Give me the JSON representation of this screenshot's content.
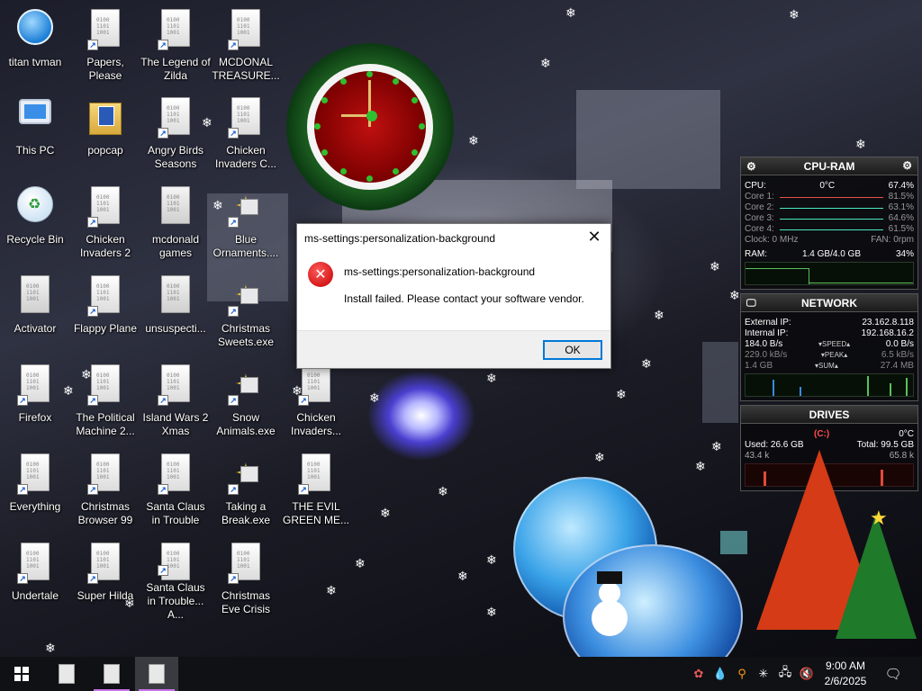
{
  "desktop": {
    "icons": [
      {
        "label": "titan tvman",
        "kind": "app"
      },
      {
        "label": "Papers, Please",
        "kind": "doc"
      },
      {
        "label": "The Legend of Zilda",
        "kind": "doc"
      },
      {
        "label": "MCDONAL TREASURE...",
        "kind": "doc"
      },
      {
        "label": "This PC",
        "kind": "pc"
      },
      {
        "label": "popcap",
        "kind": "folder"
      },
      {
        "label": "Angry Birds Seasons",
        "kind": "doc"
      },
      {
        "label": "Chicken Invaders C...",
        "kind": "doc"
      },
      {
        "label": "Recycle Bin",
        "kind": "bin"
      },
      {
        "label": "Chicken Invaders 2",
        "kind": "doc"
      },
      {
        "label": "mcdonald games",
        "kind": "file"
      },
      {
        "label": "Blue Ornaments....",
        "kind": "ornament"
      },
      {
        "label": "Activator",
        "kind": "file"
      },
      {
        "label": "Flappy Plane",
        "kind": "doc"
      },
      {
        "label": "unsuspecti...",
        "kind": "file"
      },
      {
        "label": "Christmas Sweets.exe",
        "kind": "ornament"
      },
      {
        "label": "Firefox",
        "kind": "doc"
      },
      {
        "label": "The Political Machine 2...",
        "kind": "doc"
      },
      {
        "label": "Island Wars 2 Xmas",
        "kind": "doc"
      },
      {
        "label": "Snow Animals.exe",
        "kind": "ornament"
      },
      {
        "label": "Chicken Invaders...",
        "kind": "doc"
      },
      {
        "label": "Everything",
        "kind": "doc"
      },
      {
        "label": "Christmas Browser 99",
        "kind": "doc"
      },
      {
        "label": "Santa Claus in Trouble",
        "kind": "doc"
      },
      {
        "label": "Taking a Break.exe",
        "kind": "ornament"
      },
      {
        "label": "THE EVIL GREEN ME...",
        "kind": "doc"
      },
      {
        "label": "Undertale",
        "kind": "doc"
      },
      {
        "label": "Super Hilda",
        "kind": "doc"
      },
      {
        "label": "Santa Claus in Trouble... A...",
        "kind": "doc"
      },
      {
        "label": "Christmas Eve Crisis",
        "kind": "doc"
      }
    ]
  },
  "dialog": {
    "title": "ms-settings:personalization-background",
    "close_glyph": "✕",
    "heading": "ms-settings:personalization-background",
    "message": "Install failed. Please contact your software vendor.",
    "ok_label": "OK",
    "icon": "error-icon"
  },
  "cpu_ram": {
    "title": "CPU-RAM",
    "cpu_label": "CPU:",
    "cpu_temp": "0°C",
    "cpu_percent": "67.4%",
    "cores": [
      {
        "label": "Core 1:",
        "value": "81.5%",
        "color": "#e8504a"
      },
      {
        "label": "Core 2:",
        "value": "63.1%",
        "color": "#4ae8c0"
      },
      {
        "label": "Core 3:",
        "value": "64.6%",
        "color": "#4ae8c0"
      },
      {
        "label": "Core 4:",
        "value": "61.5%",
        "color": "#4ae8c0"
      }
    ],
    "clock": "Clock: 0 MHz",
    "fan": "FAN: 0rpm",
    "ram_label": "RAM:",
    "ram_value": "1.4 GB/4.0 GB",
    "ram_percent": "34%"
  },
  "network": {
    "title": "NETWORK",
    "external_label": "External IP:",
    "external_value": "23.162.8.118",
    "internal_label": "Internal IP:",
    "internal_value": "192.168.16.2",
    "speed_down": "184.0 B/s",
    "speed_label": "▾SPEED▴",
    "speed_up": "0.0 B/s",
    "peak_down": "229.0 kB/s",
    "peak_label": "▾PEAK▴",
    "peak_up": "6.5 kB/s",
    "sum_down": "1.4 GB",
    "sum_label": "▾SUM▴",
    "sum_up": "27.4 MB"
  },
  "drives": {
    "title": "DRIVES",
    "drive_letter": "(C:)",
    "temp": "0°C",
    "used": "Used: 26.6 GB",
    "total": "Total: 99.5 GB",
    "read": "43.4 k",
    "write": "65.8 k"
  },
  "taskbar": {
    "time": "9:00 AM",
    "date": "2/6/2025",
    "tray_icons": [
      "colorful-tray-icon",
      "drop-icon",
      "search-tray-icon",
      "snowflake-icon",
      "network-icon",
      "volume-muted-icon",
      "notification-icon"
    ]
  }
}
